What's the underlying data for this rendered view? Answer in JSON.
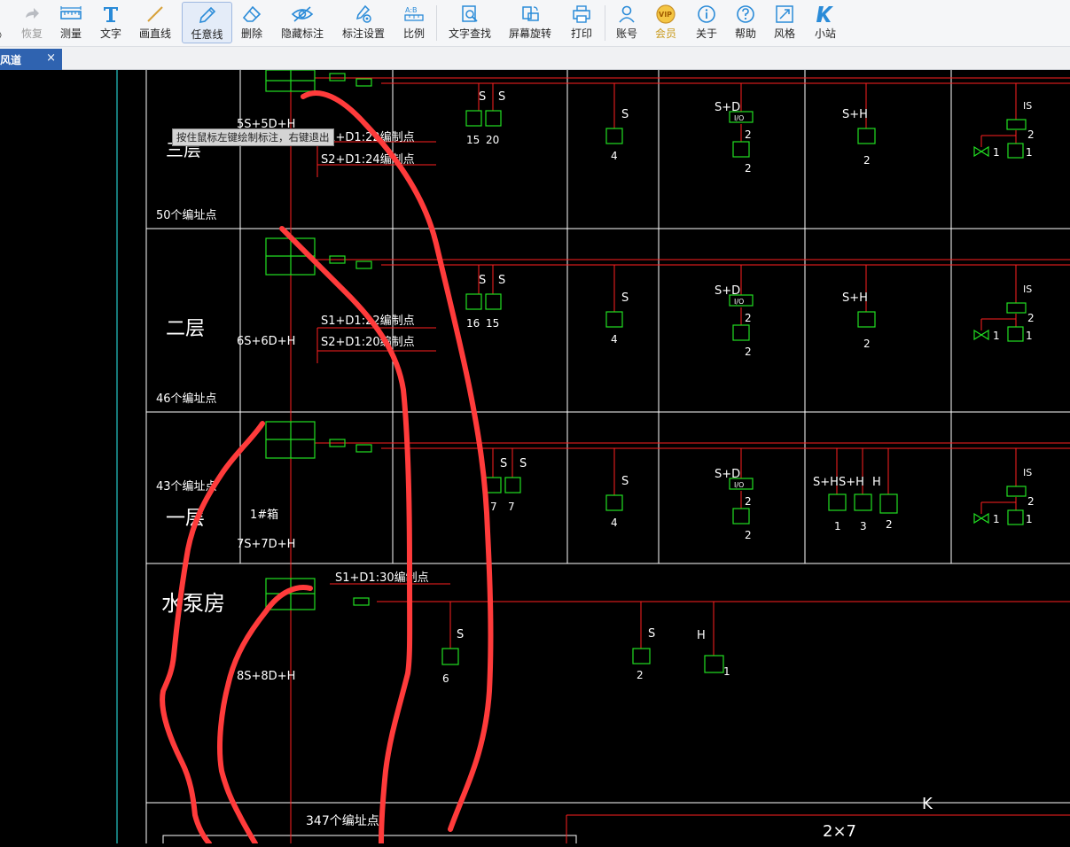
{
  "toolbar": {
    "partial_label": "》",
    "redo_label": "恢复",
    "measure_label": "测量",
    "text_label": "文字",
    "line_label": "画直线",
    "freehand_label": "任意线",
    "delete_label": "删除",
    "hide_label": "隐藏标注",
    "annot_settings_label": "标注设置",
    "ratio_label": "比例",
    "find_text_label": "文字查找",
    "rotate_label": "屏幕旋转",
    "print_label": "打印",
    "account_label": "账号",
    "vip_label": "会员",
    "about_label": "关于",
    "help_label": "帮助",
    "style_label": "风格",
    "site_label": "小站"
  },
  "tab": {
    "label": "风道",
    "close": "×"
  },
  "tooltip": "按住鼠标左键绘制标注，右键退出",
  "colors": {
    "frame": "#ffffff",
    "wire": "#ff2020",
    "device": "#22e022",
    "text": "#ffffff",
    "markup": "#ff3b3b",
    "guide": "#25c7c7"
  },
  "drawing": {
    "floors": [
      {
        "name": "三层",
        "points": "50个编址点",
        "box_label": "5S+5D+H",
        "line1": "S1+D1:22编制点",
        "line2": "S2+D1:24编制点"
      },
      {
        "name": "二层",
        "points": "46个编址点",
        "box_label": "6S+6D+H",
        "line1": "S1+D1:22编制点",
        "line2": "S2+D1:20编制点"
      },
      {
        "name": "一层",
        "points": "43个编址点",
        "box_label": "7S+7D+H",
        "box_name": "1#箱"
      },
      {
        "name": "水泵房",
        "box_label": "8S+8D+H",
        "line1": "S1+D1:30编制点"
      }
    ],
    "total_points": "347个编址点",
    "tags": {
      "s": "S",
      "ss": "S",
      "sd": "S+D",
      "sh": "S+H",
      "h": "H",
      "is": "IS",
      "k": "K",
      "io": "I/O",
      "ratio": "2×7"
    },
    "counts": {
      "f3_a": "15",
      "f3_b": "20",
      "f3_c": "4",
      "f3_d": "2",
      "f3_e": "2",
      "f3_f": "2",
      "f3_g": "2",
      "f3_h": "1",
      "f3_i": "1",
      "f2_a": "16",
      "f2_b": "15",
      "f2_c": "4",
      "f2_d": "2",
      "f2_e": "2",
      "f2_f": "2",
      "f2_g": "2",
      "f2_h": "1",
      "f2_i": "1",
      "f1_a": "7",
      "f1_b": "7",
      "f1_c": "4",
      "f1_d": "2",
      "f1_e": "2",
      "f1_f": "1",
      "f1_g": "3",
      "f1_h": "2",
      "f1_i": "2",
      "f1_j": "1",
      "f1_k": "1",
      "p_a": "6",
      "p_b": "2",
      "p_c": "1"
    }
  }
}
